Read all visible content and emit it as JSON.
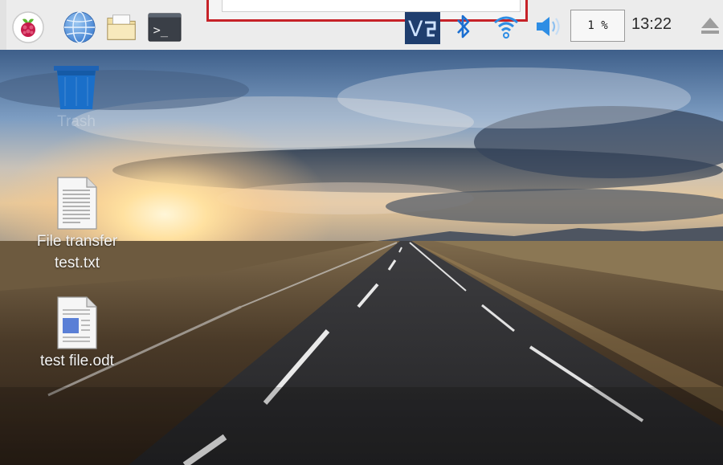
{
  "panel": {
    "launchers": [
      {
        "name": "raspberry-menu-icon"
      },
      {
        "name": "web-browser-icon"
      },
      {
        "name": "file-manager-icon"
      },
      {
        "name": "terminal-icon",
        "glyph": ">_"
      }
    ],
    "tray": {
      "vnc_label": "V",
      "vnc_icon": "vnc-server-icon",
      "bluetooth_icon": "bluetooth-icon",
      "wifi_icon": "wifi-icon",
      "volume_icon": "volume-icon",
      "cpu_usage": "1 %",
      "clock": "13:22",
      "eject_icon": "eject-icon"
    }
  },
  "desktop": {
    "icons": [
      {
        "label": "Trash",
        "icon": "trash-icon"
      },
      {
        "label_line1": "File transfer",
        "label_line2": "test.txt",
        "icon": "text-file-icon"
      },
      {
        "label": "test file.odt",
        "icon": "odt-document-icon"
      }
    ]
  },
  "colors": {
    "panel_bg": "#ececec",
    "highlight_border": "#c62228",
    "trash_blue": "#1a6fc9",
    "sky_top": "#3e5f8a",
    "road": "#2a2a2c"
  }
}
